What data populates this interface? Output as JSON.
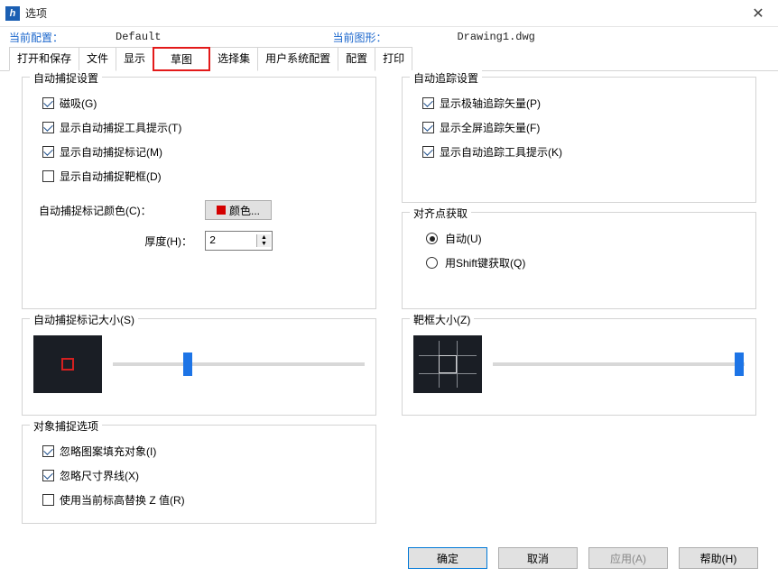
{
  "window": {
    "title": "选项",
    "close": "✕",
    "icon": "h"
  },
  "config": {
    "currentConfigLabel": "当前配置：",
    "currentConfigValue": "Default",
    "currentDrawingLabel": "当前图形：",
    "currentDrawingValue": "Drawing1.dwg"
  },
  "tabs": [
    "打开和保存",
    "文件",
    "显示",
    "草图",
    "选择集",
    "用户系统配置",
    "配置",
    "打印"
  ],
  "groups": {
    "autosnap": {
      "title": "自动捕捉设置",
      "checks": [
        {
          "label": "磁吸(G)",
          "checked": true
        },
        {
          "label": "显示自动捕捉工具提示(T)",
          "checked": true
        },
        {
          "label": "显示自动捕捉标记(M)",
          "checked": true
        },
        {
          "label": "显示自动捕捉靶框(D)",
          "checked": false
        }
      ],
      "colorLabel": "自动捕捉标记颜色(C)：",
      "colorBtn": "颜色...",
      "thicknessLabel": "厚度(H)：",
      "thicknessValue": "2"
    },
    "autotrack": {
      "title": "自动追踪设置",
      "checks": [
        {
          "label": "显示极轴追踪矢量(P)",
          "checked": true
        },
        {
          "label": "显示全屏追踪矢量(F)",
          "checked": true
        },
        {
          "label": "显示自动追踪工具提示(K)",
          "checked": true
        }
      ]
    },
    "alignment": {
      "title": "对齐点获取",
      "radios": [
        {
          "label": "自动(U)",
          "selected": true
        },
        {
          "label": "用Shift键获取(Q)",
          "selected": false
        }
      ]
    },
    "markerSize": {
      "title": "自动捕捉标记大小(S)"
    },
    "apertureSize": {
      "title": "靶框大小(Z)"
    },
    "osnap": {
      "title": "对象捕捉选项",
      "checks": [
        {
          "label": "忽略图案填充对象(I)",
          "checked": true
        },
        {
          "label": "忽略尺寸界线(X)",
          "checked": true
        },
        {
          "label": "使用当前标高替换 Z 值(R)",
          "checked": false
        }
      ]
    }
  },
  "buttons": {
    "ok": "确定",
    "cancel": "取消",
    "apply": "应用(A)",
    "help": "帮助(H)"
  }
}
